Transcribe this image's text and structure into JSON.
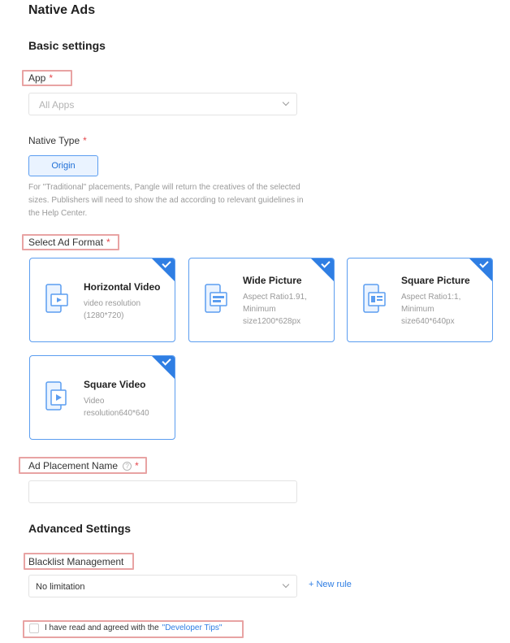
{
  "page": {
    "title": "Native Ads"
  },
  "basic_settings": {
    "title": "Basic settings"
  },
  "app": {
    "label": "App",
    "required": "*",
    "value": "All Apps"
  },
  "native_type": {
    "label": "Native Type",
    "required": "*",
    "option": "Origin",
    "hint": "For \"Traditional\" placements, Pangle will return the creatives of the selected sizes. Publishers will need to show the ad according to relevant guidelines in the Help Center."
  },
  "ad_format": {
    "label": "Select Ad Format",
    "required": "*",
    "cards": [
      {
        "title": "Horizontal Video",
        "desc1": "video resolution",
        "desc2": "(1280*720)",
        "desc3": "",
        "icon": "horizontal-video-icon",
        "checked": true
      },
      {
        "title": "Wide Picture",
        "desc1": "Aspect Ratio1.91,",
        "desc2": "Minimum",
        "desc3": "size1200*628px",
        "icon": "wide-picture-icon",
        "checked": true
      },
      {
        "title": "Square Picture",
        "desc1": "Aspect Ratio1:1,",
        "desc2": "Minimum",
        "desc3": "size640*640px",
        "icon": "square-picture-icon",
        "checked": true
      },
      {
        "title": "Square Video",
        "desc1": "Video",
        "desc2": "resolution640*640",
        "desc3": "",
        "icon": "square-video-icon",
        "checked": true
      }
    ]
  },
  "placement": {
    "label": "Ad Placement Name",
    "required": "*",
    "help_icon": "?",
    "value": ""
  },
  "advanced": {
    "title": "Advanced Settings"
  },
  "blacklist": {
    "label": "Blacklist Management",
    "value": "No limitation",
    "new_rule": "+ New rule"
  },
  "agreement": {
    "text": "I have read and agreed with the",
    "link": "\"Developer Tips\""
  },
  "colors": {
    "accent": "#2f7ee3",
    "required": "#e5484d",
    "highlight": "#e8a3a3"
  }
}
